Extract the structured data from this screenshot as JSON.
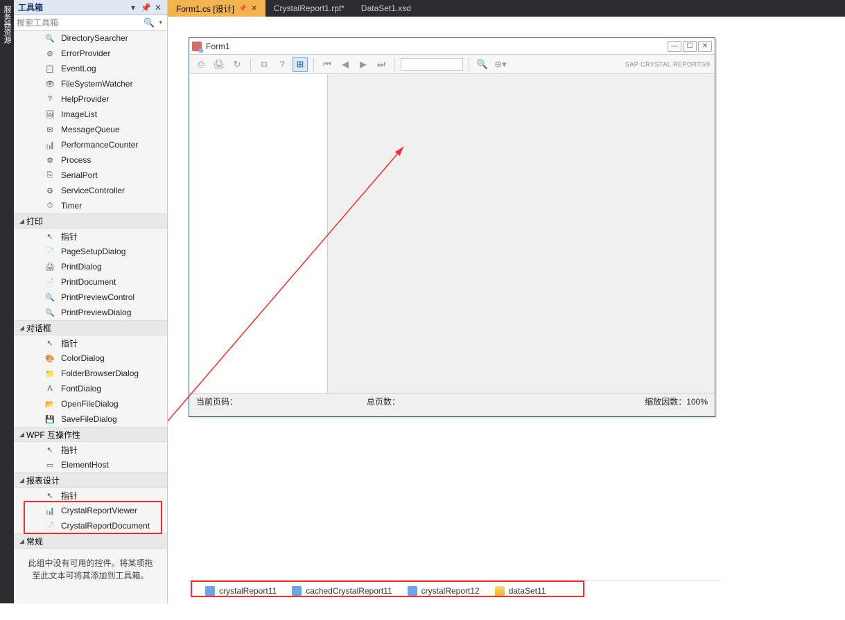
{
  "sidebar_vertical_label": "服务器资源",
  "toolbox": {
    "title": "工具箱",
    "search_placeholder": "搜索工具箱",
    "groups": [
      {
        "name": "",
        "items": [
          "DirectorySearcher",
          "ErrorProvider",
          "EventLog",
          "FileSystemWatcher",
          "HelpProvider",
          "ImageList",
          "MessageQueue",
          "PerformanceCounter",
          "Process",
          "SerialPort",
          "ServiceController",
          "Timer"
        ]
      },
      {
        "name": "打印",
        "items": [
          "指针",
          "PageSetupDialog",
          "PrintDialog",
          "PrintDocument",
          "PrintPreviewControl",
          "PrintPreviewDialog"
        ]
      },
      {
        "name": "对话框",
        "items": [
          "指针",
          "ColorDialog",
          "FolderBrowserDialog",
          "FontDialog",
          "OpenFileDialog",
          "SaveFileDialog"
        ]
      },
      {
        "name": "WPF 互操作性",
        "items": [
          "指针",
          "ElementHost"
        ]
      },
      {
        "name": "报表设计",
        "items": [
          "指针",
          "CrystalReportViewer",
          "CrystalReportDocument"
        ]
      },
      {
        "name": "常规",
        "items": []
      }
    ],
    "empty_msg": "此组中没有可用的控件。将某项拖至此文本可将其添加到工具箱。"
  },
  "tabs": [
    {
      "label": "Form1.cs [设计]",
      "active": true
    },
    {
      "label": "CrystalReport1.rpt*",
      "active": false
    },
    {
      "label": "DataSet1.xsd",
      "active": false
    }
  ],
  "form": {
    "title": "Form1",
    "brand": "SAP CRYSTAL REPORTS®",
    "status": {
      "page": "当前页码：",
      "total": "总页数：",
      "zoom": "缩放因数：100%"
    }
  },
  "tray": [
    {
      "label": "crystalReport11",
      "kind": "cr"
    },
    {
      "label": "cachedCrystalReport11",
      "kind": "cr"
    },
    {
      "label": "crystalReport12",
      "kind": "cr"
    },
    {
      "label": "dataSet11",
      "kind": "db"
    }
  ]
}
